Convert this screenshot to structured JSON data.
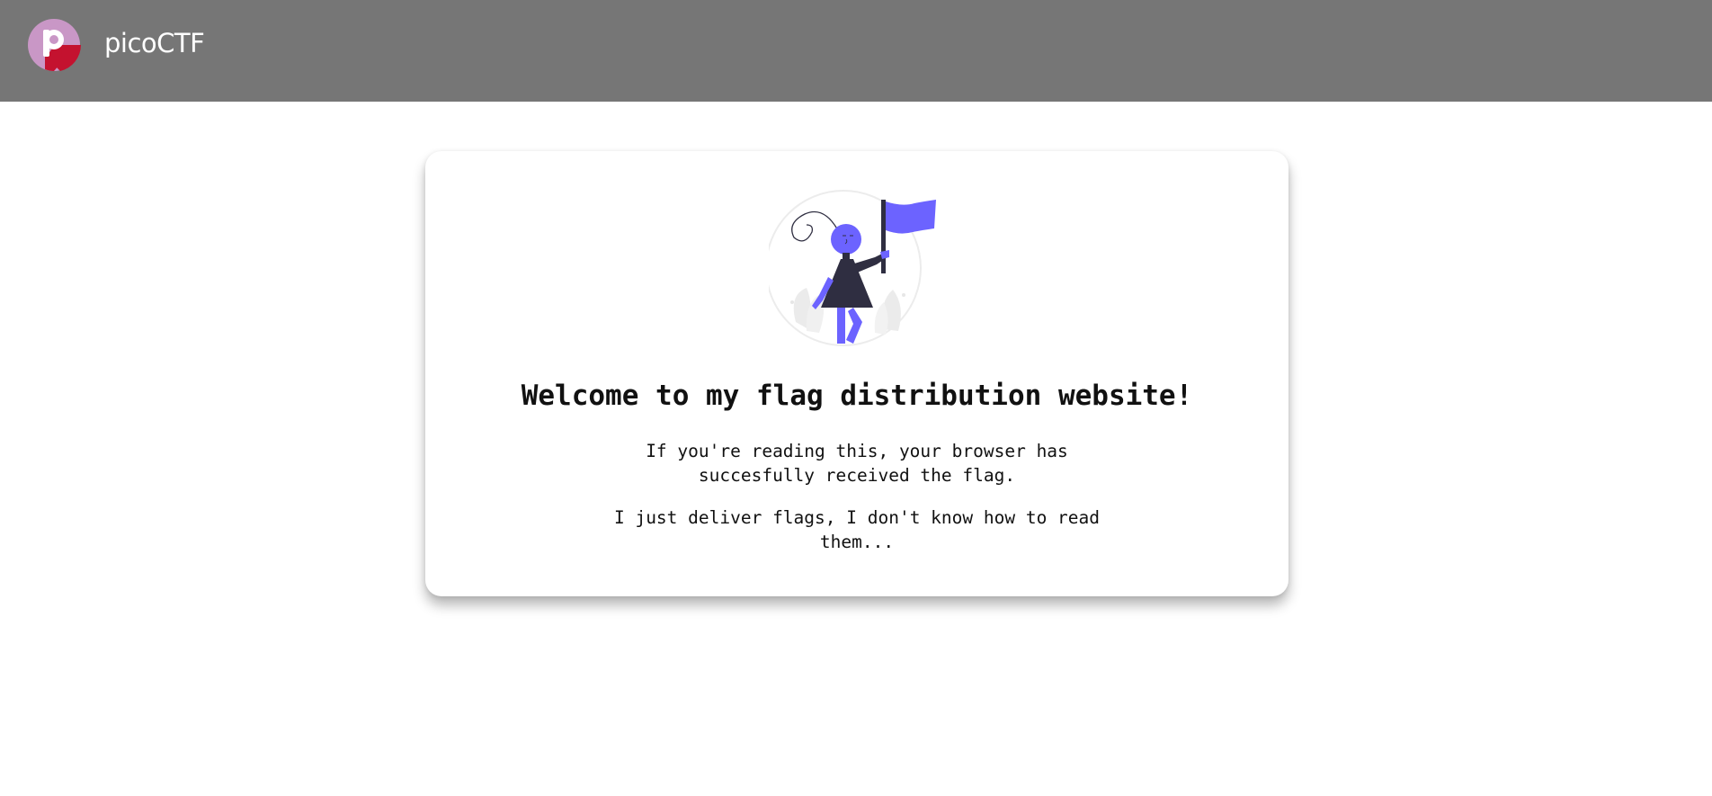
{
  "header": {
    "brand": "picoCTF",
    "logo_icon": "picoctf-logo-icon",
    "background_color": "#767676"
  },
  "main": {
    "illustration": "woman-holding-flag-illustration",
    "heading": "Welcome to my flag distribution website!",
    "paragraph_1": "If you're reading this, your browser has succesfully received the flag.",
    "paragraph_2": "I just deliver flags, I don't know how to read them...",
    "accent_color": "#6c63ff"
  }
}
